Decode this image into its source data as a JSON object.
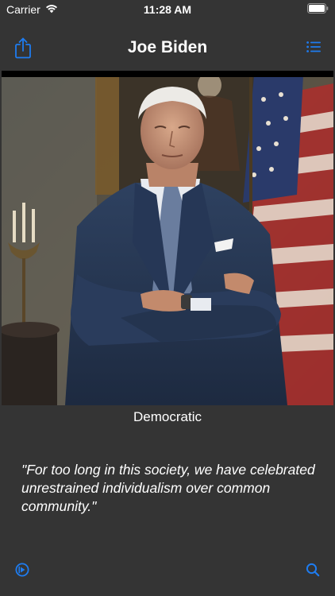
{
  "status_bar": {
    "carrier": "Carrier",
    "time": "11:28 AM"
  },
  "nav": {
    "title": "Joe Biden"
  },
  "portrait": {
    "party": "Democratic"
  },
  "quote": {
    "text": "\"For too long in this society, we have celebrated unrestrained individualism over common community.\""
  },
  "colors": {
    "accent": "#1e7cf0",
    "background": "#343434",
    "text": "#ffffff"
  },
  "icons": {
    "share": "share-icon",
    "list": "list-icon",
    "play": "play-circle-icon",
    "search": "search-icon",
    "wifi": "wifi-icon",
    "battery": "battery-icon"
  }
}
